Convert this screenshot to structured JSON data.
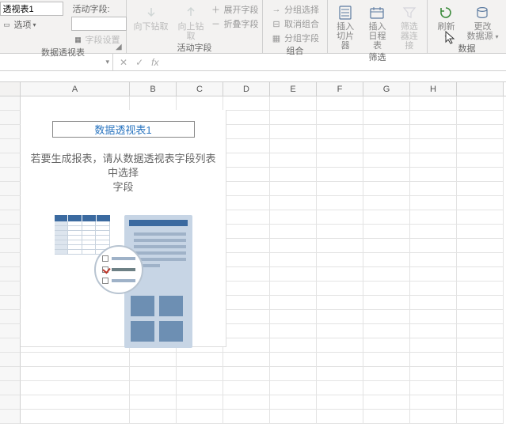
{
  "ribbon": {
    "pivot_options": {
      "name_value": "透视表1",
      "active_field_label": "活动字段:",
      "options_label": "选项",
      "field_settings_label": "字段设置",
      "group_label": "数据透视表"
    },
    "active_field": {
      "drill_down": "向下钻取",
      "drill_up_line1": "向上钻",
      "drill_up_line2": "取",
      "expand_field": "展开字段",
      "collapse_field": "折叠字段",
      "group_label": "活动字段"
    },
    "group": {
      "group_selection": "分组选择",
      "ungroup": "取消组合",
      "group_field": "分组字段",
      "group_label": "组合"
    },
    "filter": {
      "insert_slicer_l1": "插入",
      "insert_slicer_l2": "切片器",
      "insert_timeline_l1": "插入",
      "insert_timeline_l2": "日程表",
      "filter_connect_l1": "筛选",
      "filter_connect_l2": "器连接",
      "group_label": "筛选"
    },
    "data": {
      "refresh": "刷新",
      "change_source_l1": "更改",
      "change_source_l2": "数据源",
      "group_label": "数据"
    }
  },
  "namebox": {
    "value": ""
  },
  "columns": [
    "A",
    "B",
    "C",
    "D",
    "E",
    "F",
    "G",
    "H"
  ],
  "pivot_placeholder": {
    "title": "数据透视表1",
    "desc_line1": "若要生成报表，请从数据透视表字段列表中选择",
    "desc_line2": "字段"
  }
}
